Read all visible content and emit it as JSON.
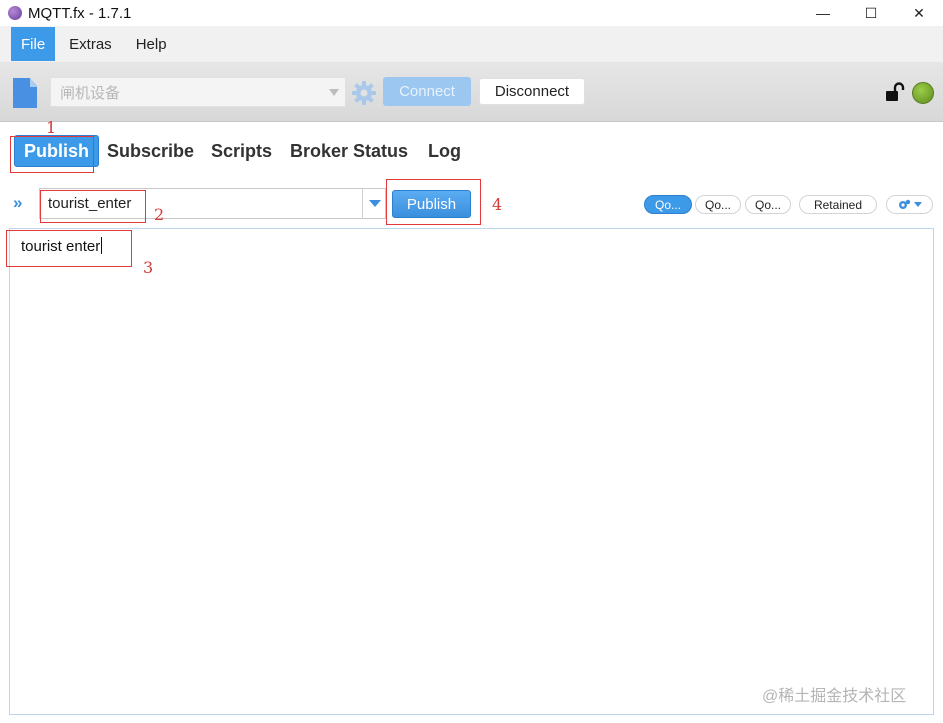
{
  "window": {
    "title": "MQTT.fx - 1.7.1",
    "minimize_glyph": "—",
    "maximize_glyph": "☐",
    "close_glyph": "✕"
  },
  "menu": {
    "items": [
      {
        "label": "File",
        "active": true
      },
      {
        "label": "Extras",
        "active": false
      },
      {
        "label": "Help",
        "active": false
      }
    ]
  },
  "toolbar": {
    "profile_value": "闸机设备",
    "connect_label": "Connect",
    "disconnect_label": "Disconnect",
    "icons": [
      "file-icon",
      "gear-icon",
      "lock-open-icon",
      "status-light-icon"
    ],
    "status_color": "#6fa22a"
  },
  "tabs": [
    {
      "label": "Publish",
      "active": true
    },
    {
      "label": "Subscribe",
      "active": false
    },
    {
      "label": "Scripts",
      "active": false
    },
    {
      "label": "Broker Status",
      "active": false
    },
    {
      "label": "Log",
      "active": false
    }
  ],
  "publish": {
    "expand_glyph": "»",
    "topic_value": "tourist_enter",
    "publish_label": "Publish",
    "qos_options": [
      {
        "label": "Qo...",
        "active": true
      },
      {
        "label": "Qo...",
        "active": false
      },
      {
        "label": "Qo...",
        "active": false
      }
    ],
    "retained_label": "Retained"
  },
  "payload": {
    "text": "tourist enter"
  },
  "annotations": {
    "numbers": [
      "1",
      "2",
      "3",
      "4"
    ],
    "color": "#e23a3a"
  },
  "watermark": "@稀土掘金技术社区",
  "accent_color": "#3c9ae8"
}
